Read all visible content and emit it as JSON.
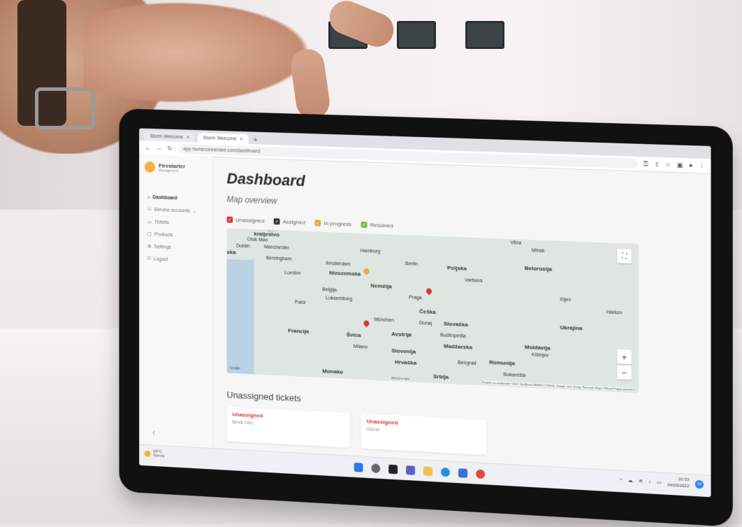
{
  "browser": {
    "tabs": [
      {
        "label": "Storm Welcome"
      },
      {
        "label": "Storm Welcome"
      }
    ],
    "url": "app.homeconnected.com/dashboard"
  },
  "sidebar": {
    "brand_name": "Firestarter",
    "brand_sub": "Management",
    "items": [
      {
        "label": "Dashboard"
      },
      {
        "label": "Service accounts"
      },
      {
        "label": "Tickets"
      },
      {
        "label": "Products"
      },
      {
        "label": "Settings"
      },
      {
        "label": "Logout"
      }
    ],
    "collapse_glyph": "‹"
  },
  "main": {
    "title": "Dashboard",
    "map_section": "Map overview",
    "legend": [
      {
        "label": "Unassigned",
        "color": "#d63535"
      },
      {
        "label": "Assigned",
        "color": "#333333"
      },
      {
        "label": "In progress",
        "color": "#e0a93b"
      },
      {
        "label": "Resolved",
        "color": "#7db847"
      }
    ],
    "map": {
      "labels": {
        "kraljestvo": "kraljestvo",
        "isleofman": "Otok Man",
        "dublin": "Dublin",
        "manchester": "Manchester",
        "ska": "ska",
        "birmingham": "Birmingham",
        "london": "London",
        "amsterdam": "Amsterdam",
        "nizozemska": "Nizozemska",
        "hamburg": "Hamburg",
        "berlin": "Berlin",
        "poljska": "Poljska",
        "varsava": "Varšava",
        "vilna": "Vilna",
        "minsk": "Minsk",
        "belorusija": "Belorusija",
        "nemcija": "Nemčija",
        "belgija": "Belgija",
        "luksemburg": "Luksemburg",
        "praga": "Praga",
        "ceska": "Češka",
        "kijev": "Kijev",
        "harkov": "Harkov",
        "pariz": "Pariz",
        "munchen": "München",
        "dunaj": "Dunaj",
        "slovaska": "Slovaška",
        "ukrajina": "Ukrajina",
        "francija": "Francija",
        "svica": "Švica",
        "avstrija": "Avstrija",
        "budimpesta": "Budimpešta",
        "madzarska": "Madžarska",
        "moldavija": "Moldavija",
        "kisinjev": "Kišinjev",
        "milano": "Milano",
        "slovenija": "Slovenija",
        "hrvaska": "Hrvaška",
        "romunija": "Romunija",
        "beograd": "Beograd",
        "bukaresta": "Bukarešta",
        "monako": "Monako",
        "srbija": "Srbija"
      },
      "zoom_in": "+",
      "zoom_out": "−",
      "fullscreen": "⛶",
      "keyboard": "Bližnjične tipke",
      "attribution": "Podatki na zemljevidu ©2022 GeoBasis-DE/BKG (©2009), Google, Inst. Geogr. Nacional, Mapa GISrael",
      "terms": "Pogoji uporabe",
      "google": "Google"
    },
    "unassigned_title": "Unassigned tickets",
    "cards": [
      {
        "status": "Unassigned",
        "sub": "Brnik 24m"
      },
      {
        "status": "Unassigned",
        "sub": "Gecat"
      }
    ]
  },
  "taskbar": {
    "weather_temp": "18°C",
    "weather_desc": "Sunny",
    "time": "10:33",
    "date": "04/05/2022",
    "notifications": "10"
  }
}
